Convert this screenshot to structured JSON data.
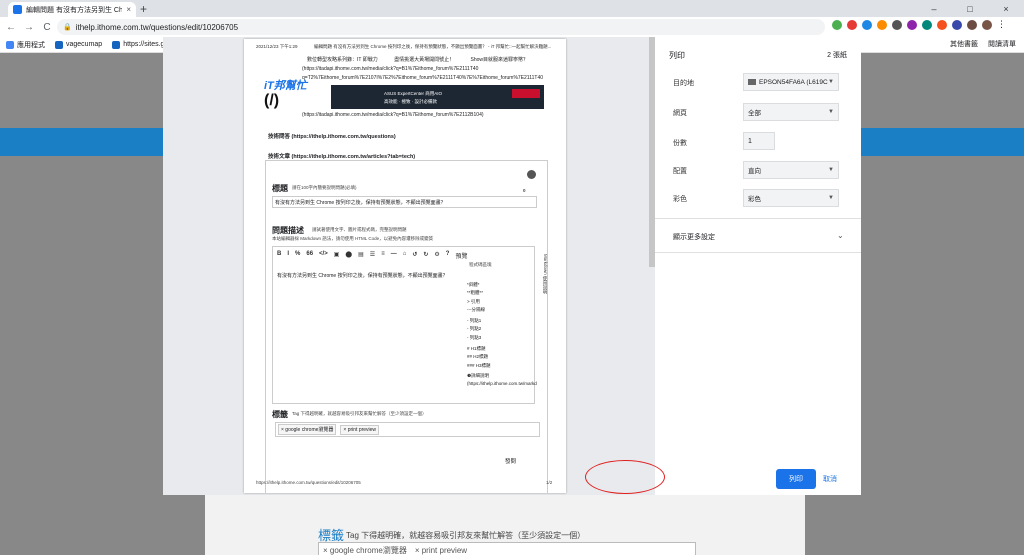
{
  "browser": {
    "tab_title": "編輯問題 有沒有方法另到生 Chro",
    "tab_close": "×",
    "new_tab": "+",
    "url": "ithelp.ithome.com.tw/questions/edit/10206705",
    "back": "←",
    "forward": "→",
    "reload": "C",
    "win_min": "–",
    "win_max": "□",
    "win_close": "×"
  },
  "bookmarks": {
    "items": [
      "應用程式",
      "vagecumap",
      "https://sites.g"
    ],
    "right": [
      "其他書籤",
      "閱讀清單"
    ]
  },
  "print_panel": {
    "title": "列印",
    "pages": "2 張紙",
    "destination_label": "目的地",
    "destination_value": "EPSON54FA6A (L619C",
    "pages_label": "網頁",
    "pages_value": "全部",
    "copies_label": "份數",
    "copies_value": "1",
    "layout_label": "配置",
    "layout_value": "直向",
    "color_label": "彩色",
    "color_value": "彩色",
    "more_settings": "顯示更多設定",
    "print_button": "列印",
    "cancel_button": "取消"
  },
  "preview": {
    "header_date": "2021/12/23 下午1:29",
    "header_title": "編輯問題 有沒有方法另到生 Chrome 按列印之後，保持有預覽狀態，不顯出預覽面畫？ - iT 邦幫忙::一起幫忙解決難題...",
    "line1": "數位轉型攻略系列錄：IT 即戰力　　　 盡情挑選大黃場開問號止！　　　 Show目就服來逍罪寧幣？",
    "line2": "(https://itadapi.ithome.com.tw/media/click?q=B1%7Eithome_forum%7E2111T40",
    "line3": "q=T2%7Eithome_forum%7E2107I%7E2%7Eithome_forum%7E2111T40%7E%7Eithome_forum%7E2111T40",
    "logo": "iT邦幫忙",
    "logo_sub": "(/)",
    "banner_text": "ASUS ExpertCenter 商用AIO",
    "banner_sub": "高效能 · 極致 · 設計必備款",
    "line4": "(https://itadapi.ithome.com.tw/media/click?q=B1%7Eithome_forum%7E2112B104)",
    "sec1": "技術問答 (https://ithelp.ithome.com.tw/questions)",
    "sec2": "技術文章 (https://ithelp.ithome.com.tw/articles?tab=tech)",
    "title_heading": "標題",
    "title_hint": "請在100字內簡要說明問題(必填)",
    "title_count": "0",
    "title_value": "有沒有方法另到生 Chrome 按列印之後，保持有預覽狀態，不顯出預覽面畫？",
    "desc_heading": "問題描述",
    "desc_hint": "請試著使用文字、圖片或程式碼，完整說明問題",
    "desc_hint2": "本站編輯器採 Markdown 語法，請勿使用 HTML Code，以避免內容遭移除或變質",
    "toolbar": [
      "B",
      "I",
      "%",
      "66",
      "</>",
      "▣",
      "⬤",
      "▤",
      "☰",
      "≡",
      "—",
      "⌂",
      "↺",
      "↻",
      "⚙",
      "?"
    ],
    "preview_label": "預覽",
    "format_hint": "程式碼區塊",
    "editor_text": "有沒有方法另到生 Chrome 按列印之後，保持有預覽狀態，不顯出預覽面畫？",
    "md_list": [
      "*斜體*",
      "**粗體**",
      "> 引用",
      "---分隔線",
      "- 列點1",
      "- 列點2",
      "- 列點3",
      "# H1標題",
      "## H2標題",
      "### H3標題",
      "❶詳細說明",
      "(https://ithelp.ithome.com.tw/markd"
    ],
    "md_side": "Markdown 使用說明",
    "tag_heading": "標籤",
    "tag_hint": "Tag 下得越明確，就越容易吸引邦友來幫忙解答（至少須設定一個）",
    "tags": [
      "× google chrome瀏覽器",
      "× print preview"
    ],
    "publish": "發問",
    "footer_url": "https://ithelp.ithome.com.tw/questions/edit/10206705",
    "footer_page": "1/2"
  },
  "background": {
    "tag_heading": "標籤",
    "tag_hint": "Tag 下得越明確，就越容易吸引邦友來幫忙解答（至少須設定一個）",
    "tags": "× google chrome瀏覽器　× print preview"
  }
}
